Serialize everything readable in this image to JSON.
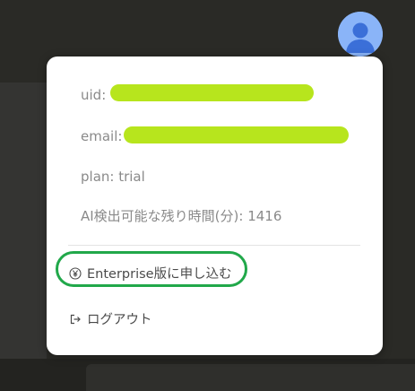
{
  "user": {
    "uid_label": "uid:",
    "email_label": "email:",
    "plan_label": "plan: trial",
    "ai_remaining_label": "AI検出可能な残り時間(分): 1416"
  },
  "menu": {
    "enterprise_label": "Enterprise版に申し込む",
    "logout_label": "ログアウト"
  },
  "icons": {
    "avatar": "account-avatar-icon",
    "enterprise": "yen-circle-icon",
    "logout": "logout-icon"
  },
  "colors": {
    "avatar_bg": "#8ab4f8",
    "avatar_fg": "#3b6fd8",
    "redaction": "#b7e51d",
    "highlight_ring": "#21a84a",
    "menu_bg": "#ffffff",
    "info_text": "#8a8a8a"
  }
}
